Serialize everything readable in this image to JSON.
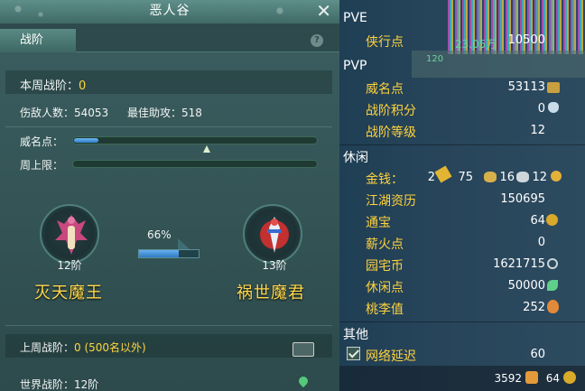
{
  "window": {
    "title": "恶人谷"
  },
  "tabs": [
    {
      "label": "战阶"
    }
  ],
  "left": {
    "weekly_rank_label": "本周战阶：",
    "weekly_rank_value": "0",
    "kills_label": "伤敌人数：",
    "kills_value": "54053",
    "assist_label": "最佳助攻：",
    "assist_value": "518",
    "prestige_label": "威名点：",
    "prestige_fill": 0.1,
    "weekly_cap_label": "周上限：",
    "weekly_cap_fill": 0,
    "current": {
      "rank": "12阶",
      "title": "灭天魔王"
    },
    "next": {
      "rank": "13阶",
      "title": "祸世魔君"
    },
    "progress_text": "66%",
    "progress": 0.66,
    "last_week_label": "上周战阶：",
    "last_week_value": "0 (500名以外)",
    "world_label": "世界战阶：",
    "world_value": "12阶"
  },
  "right": {
    "pve": {
      "header": "PVE",
      "items": [
        {
          "label": "侠行点",
          "value": "10500"
        }
      ]
    },
    "pvp": {
      "header": "PVP",
      "items": [
        {
          "label": "威名点",
          "value": "53113"
        },
        {
          "label": "战阶积分",
          "value": "0"
        },
        {
          "label": "战阶等级",
          "value": "12"
        }
      ]
    },
    "leisure": {
      "header": "休闲",
      "money": {
        "label": "金钱：",
        "gold": "2",
        "silver": "75",
        "copper1": "16",
        "copper2": "12"
      },
      "items": [
        {
          "label": "江湖资历",
          "value": "150695"
        },
        {
          "label": "通宝",
          "value": "64"
        },
        {
          "label": "薪火点",
          "value": "0"
        },
        {
          "label": "园宅币",
          "value": "1621715"
        },
        {
          "label": "休闲点",
          "value": "50000"
        },
        {
          "label": "桃李值",
          "value": "252"
        }
      ]
    },
    "other": {
      "header": "其他",
      "items": [
        {
          "label": "网络延迟",
          "value": "60"
        }
      ]
    },
    "bottom": {
      "left_value": "3592",
      "right_value": "64"
    },
    "bg_text": {
      "a": "23.05万",
      "b": "120"
    }
  }
}
